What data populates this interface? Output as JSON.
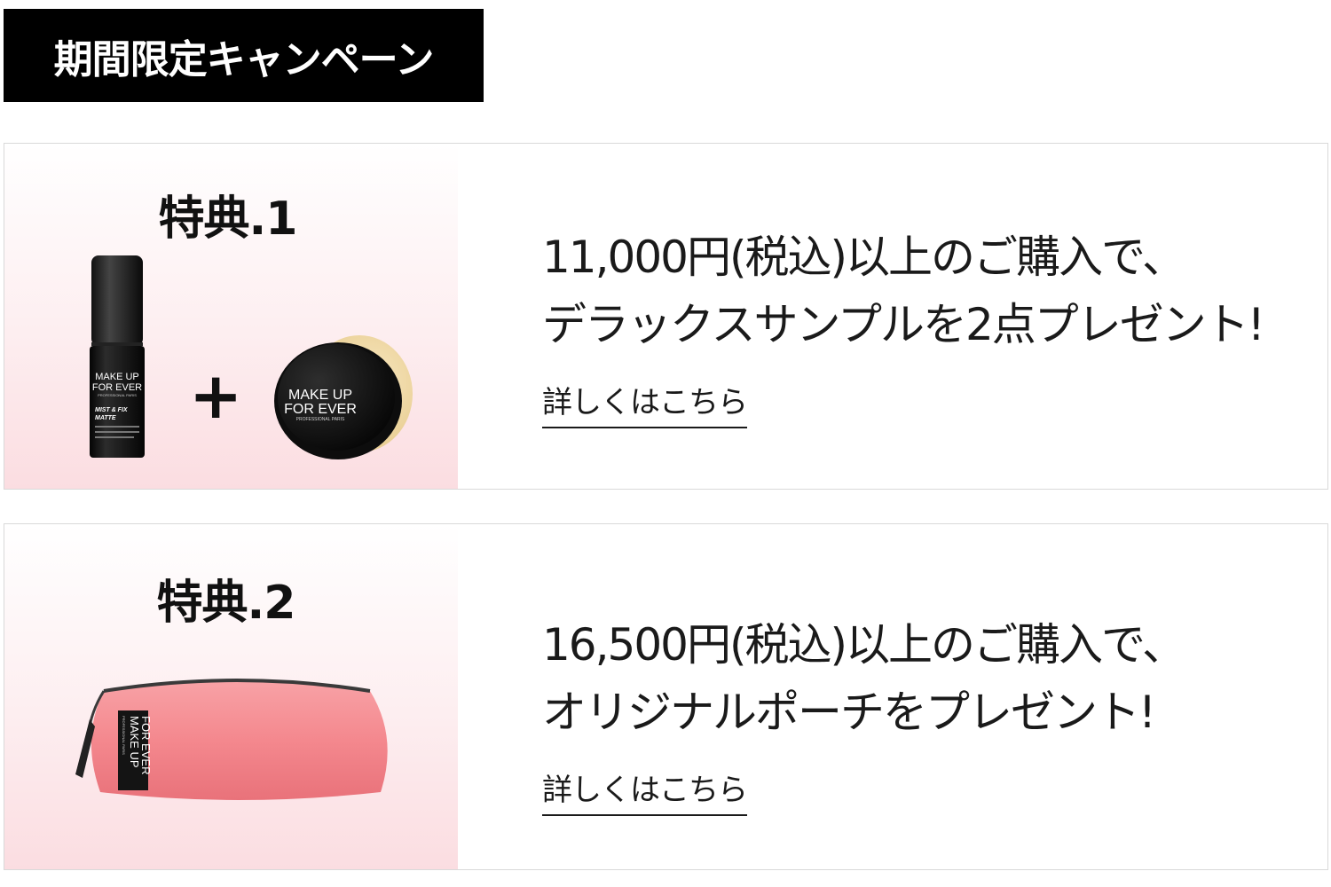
{
  "header": {
    "title": "期間限定キャンペーン"
  },
  "benefits": [
    {
      "title": "特典.1",
      "line1": "11,000円(税込)以上のご購入で、",
      "line2": "デラックスサンプルを2点プレゼント!",
      "link_label": "詳しくはこちら",
      "plus": "+",
      "products": {
        "spray_brand_1": "MAKE UP",
        "spray_brand_2": "FOR EVER",
        "spray_brand_3": "PROFESSIONAL PARIS",
        "spray_name_1": "MIST & FIX",
        "spray_name_2": "MATTE",
        "jar_brand_1": "MAKE UP",
        "jar_brand_2": "FOR EVER",
        "jar_brand_3": "PROFESSIONAL PARIS"
      }
    },
    {
      "title": "特典.2",
      "line1": "16,500円(税込)以上のご購入で、",
      "line2": "オリジナルポーチをプレゼント!",
      "link_label": "詳しくはこちら",
      "products": {
        "pouch_brand_1": "MAKE UP",
        "pouch_brand_2": "FOR EVER",
        "pouch_brand_3": "PROFESSIONAL PARIS"
      }
    }
  ],
  "colors": {
    "header_bg": "#000000",
    "card_gradient_bottom": "#fbdde1",
    "pouch": "#f4888e",
    "jar_powder": "#f3dcae"
  }
}
